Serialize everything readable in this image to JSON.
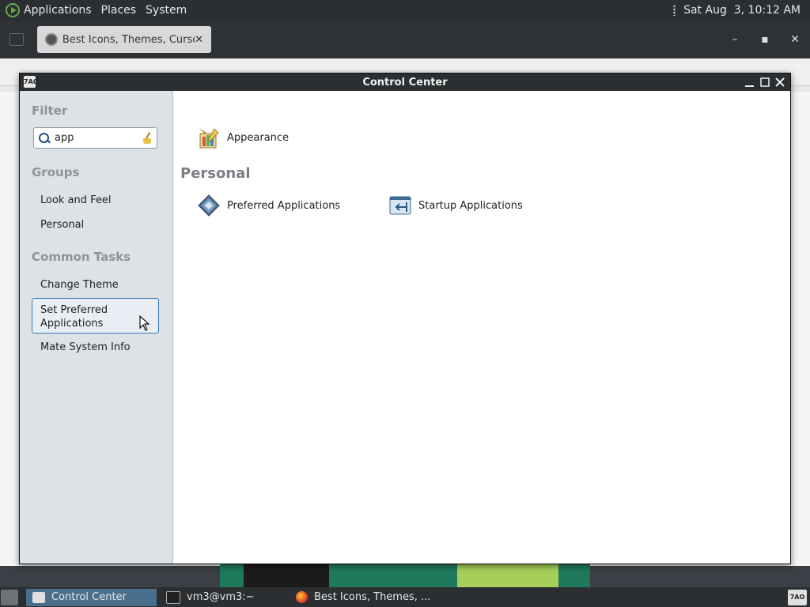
{
  "top_panel": {
    "menus": [
      "Applications",
      "Places",
      "System"
    ],
    "clock": "Sat Aug  3, 10:12 AM"
  },
  "browser": {
    "tab_title": "Best Icons, Themes, Curson",
    "tab_close": "✕",
    "window_controls": {
      "minimize": "–",
      "maximize": "▪",
      "close": "✕"
    }
  },
  "control_center": {
    "title": "Control Center",
    "icon_text": "7AO",
    "controls": {
      "minimize": "_",
      "maximize": "☐",
      "close": "✕"
    },
    "sidebar": {
      "filter_heading": "Filter",
      "filter_value": "app",
      "groups_heading": "Groups",
      "groups": [
        "Look and Feel",
        "Personal"
      ],
      "tasks_heading": "Common Tasks",
      "tasks": {
        "change_theme": "Change Theme",
        "set_preferred_line1": "Set Preferred",
        "set_preferred_line2": "Applications",
        "mate_system_info": "Mate System Info"
      }
    },
    "main": {
      "look_and_feel_items": [
        "Appearance"
      ],
      "personal_heading": "Personal",
      "personal_items": [
        "Preferred Applications",
        "Startup Applications"
      ]
    }
  },
  "taskbar": {
    "tasks": [
      "Control Center",
      "vm3@vm3:~",
      "Best Icons, Themes, ..."
    ],
    "tray_icon_text": "7AO"
  },
  "colors": {
    "panel": "#2b2f32",
    "sidebar": "#dce2e6",
    "selection_border": "#3c78b0",
    "active_task": "#4a6f8c"
  }
}
